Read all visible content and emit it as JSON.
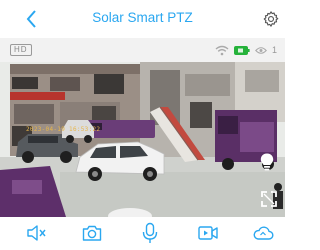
{
  "header": {
    "title": "Solar Smart PTZ",
    "back_icon": "chevron-left-icon",
    "settings_icon": "gear-icon"
  },
  "status": {
    "quality_badge": "HD",
    "wifi_icon": "wifi-icon",
    "battery_icon": "battery-icon",
    "viewers_icon": "eye-icon",
    "viewer_count": "1"
  },
  "video": {
    "timestamp": "2023-04-19 16:53:22",
    "overlay_icons": [
      "lightbulb-icon",
      "fullscreen-icon"
    ]
  },
  "toolbar": {
    "items": [
      "speaker-mute-icon",
      "camera-icon",
      "microphone-icon",
      "video-record-icon",
      "cloud-icon"
    ]
  },
  "colors": {
    "accent": "#2aa7f0",
    "battery": "#25b23a",
    "timestamp": "#e7b64a"
  }
}
